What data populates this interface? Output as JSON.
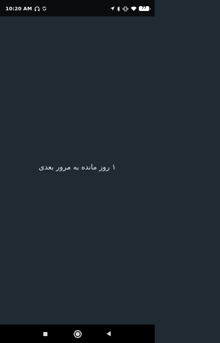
{
  "status_bar": {
    "time": "10:20 AM",
    "battery_level": "77",
    "left_icons": [
      "headphones-icon",
      "sync-icon"
    ],
    "right_icons": [
      "location-icon",
      "bluetooth-icon",
      "vibrate-icon",
      "wifi-icon",
      "battery-icon"
    ]
  },
  "main": {
    "message": "۱ روز مانده به مرور بعدی"
  },
  "nav_bar": {
    "buttons": [
      "recents-icon",
      "home-icon",
      "back-icon"
    ]
  },
  "colors": {
    "background": "#1f2a33",
    "status_bar": "#0a0d10",
    "nav_bar": "#000000",
    "text": "#e8ecef"
  }
}
